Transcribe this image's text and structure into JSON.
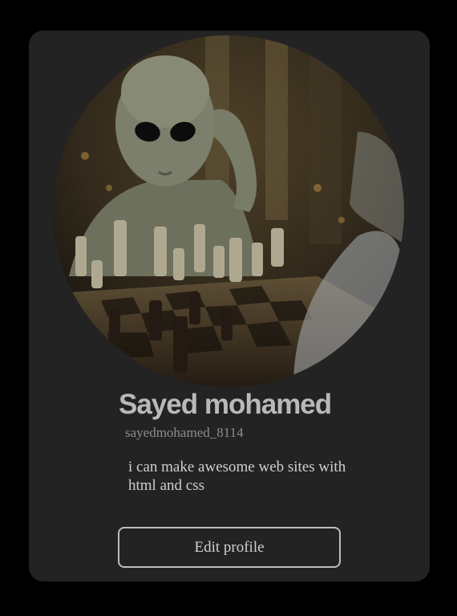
{
  "profile": {
    "name": "Sayed mohamed",
    "username": "sayedmohamed_8114",
    "bio": "i can make awesome web sites with html and css",
    "edit_button_label": "Edit profile",
    "avatar_alt": "alien playing chess"
  },
  "colors": {
    "page_background": "#000000",
    "card_background": "#232323",
    "name_color": "#b9b9b9",
    "username_color": "#8d8d8d",
    "bio_color": "#cfcfcf",
    "button_border": "#bdbdbd"
  }
}
